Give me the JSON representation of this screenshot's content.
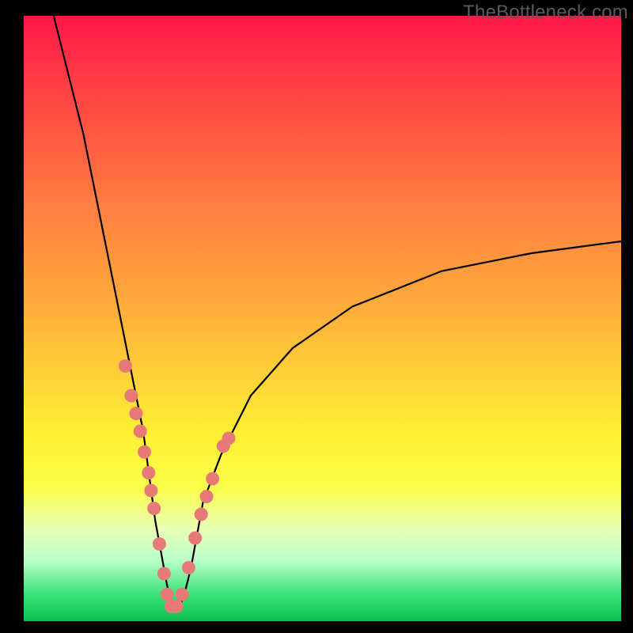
{
  "watermark": "TheBottleneck.com",
  "colors": {
    "frame": "#000000",
    "curve": "#000000",
    "dots": "#e77a78",
    "gradient_top": "#ff1848",
    "gradient_bottom": "#10c050"
  },
  "chart_data": {
    "type": "line",
    "title": "",
    "xlabel": "",
    "ylabel": "",
    "xlim": [
      0,
      100
    ],
    "ylim": [
      -2,
      100
    ],
    "grid": false,
    "legend": false,
    "annotations": [
      "TheBottleneck.com"
    ],
    "series": [
      {
        "name": "bottleneck-curve",
        "x": [
          5,
          10,
          15,
          18,
          20,
          22,
          24,
          25,
          26,
          27,
          28,
          30,
          33,
          38,
          45,
          55,
          70,
          85,
          100
        ],
        "y": [
          100,
          80,
          55,
          40,
          30,
          15,
          4,
          0,
          0,
          3,
          7,
          18,
          26,
          36,
          44,
          51,
          57,
          60,
          62
        ]
      }
    ],
    "points": {
      "name": "sample-dots",
      "x": [
        17.0,
        18.0,
        18.8,
        19.5,
        20.2,
        20.9,
        21.3,
        21.8,
        22.7,
        23.5,
        24.0,
        24.7,
        25.6,
        26.5,
        27.6,
        28.7,
        29.7,
        30.6,
        31.6,
        33.4,
        34.3
      ],
      "y": [
        41.0,
        36.0,
        33.0,
        30.0,
        26.5,
        23.0,
        20.0,
        17.0,
        11.0,
        6.0,
        2.5,
        0.5,
        0.5,
        2.5,
        7.0,
        12.0,
        16.0,
        19.0,
        22.0,
        27.5,
        28.8
      ]
    }
  }
}
